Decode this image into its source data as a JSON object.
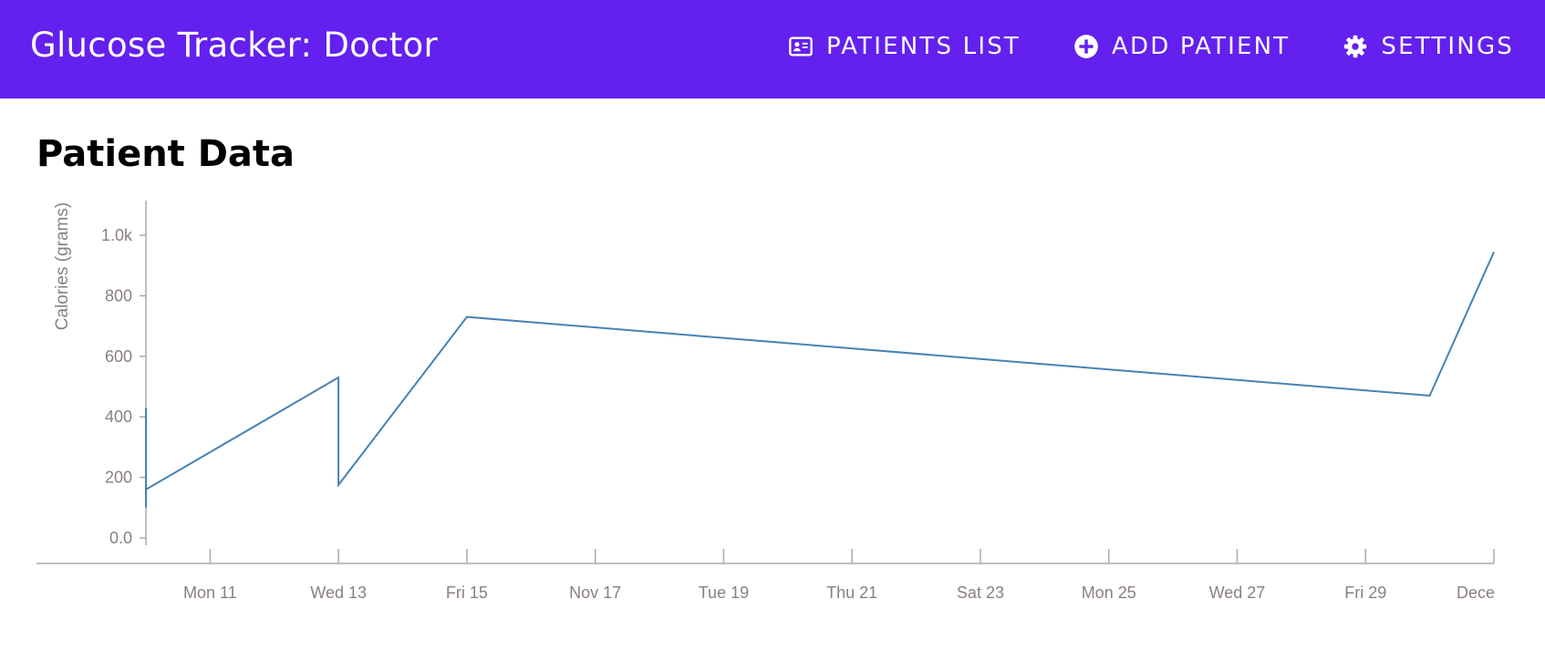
{
  "app": {
    "title": "Glucose Tracker: Doctor"
  },
  "nav": [
    {
      "id": "patients-list",
      "label": "PATIENTS LIST",
      "icon": "id-card-icon"
    },
    {
      "id": "add-patient",
      "label": "ADD PATIENT",
      "icon": "add-circle-icon"
    },
    {
      "id": "settings",
      "label": "SETTINGS",
      "icon": "gear-icon"
    }
  ],
  "page": {
    "title": "Patient Data"
  },
  "colors": {
    "appbar": "#6320ee",
    "line": "#4682b4",
    "axis": "#aaaaaa",
    "tick_text": "#8a7f7f"
  },
  "chart_data": {
    "type": "line",
    "ylabel": "Calories (grams)",
    "xlabel": "",
    "ylim": [
      0,
      1000
    ],
    "y_ticks": [
      {
        "value": 0,
        "label": "0.0"
      },
      {
        "value": 200,
        "label": "200"
      },
      {
        "value": 400,
        "label": "400"
      },
      {
        "value": 600,
        "label": "600"
      },
      {
        "value": 800,
        "label": "800"
      },
      {
        "value": 1000,
        "label": "1.0k"
      }
    ],
    "x_ticks": [
      {
        "date": "2018-11-11",
        "label": "Mon 11"
      },
      {
        "date": "2018-11-13",
        "label": "Wed 13"
      },
      {
        "date": "2018-11-15",
        "label": "Fri 15"
      },
      {
        "date": "2018-11-17",
        "label": "Nov 17"
      },
      {
        "date": "2018-11-19",
        "label": "Tue 19"
      },
      {
        "date": "2018-11-21",
        "label": "Thu 21"
      },
      {
        "date": "2018-11-23",
        "label": "Sat 23"
      },
      {
        "date": "2018-11-25",
        "label": "Mon 25"
      },
      {
        "date": "2018-11-27",
        "label": "Wed 27"
      },
      {
        "date": "2018-11-29",
        "label": "Fri 29"
      },
      {
        "date": "2018-12-01",
        "label": "Dece"
      }
    ],
    "xlim": [
      "2018-11-10",
      "2018-12-01"
    ],
    "grid": false,
    "series": [
      {
        "points": [
          {
            "x": "2018-11-10",
            "y": 100
          },
          {
            "x": "2018-11-10",
            "y": 430
          },
          {
            "x": "2018-11-10",
            "y": 160
          },
          {
            "x": "2018-11-13",
            "y": 530
          },
          {
            "x": "2018-11-13",
            "y": 175
          },
          {
            "x": "2018-11-15",
            "y": 730
          },
          {
            "x": "2018-11-30",
            "y": 470
          },
          {
            "x": "2018-12-01",
            "y": 945
          }
        ]
      }
    ]
  }
}
